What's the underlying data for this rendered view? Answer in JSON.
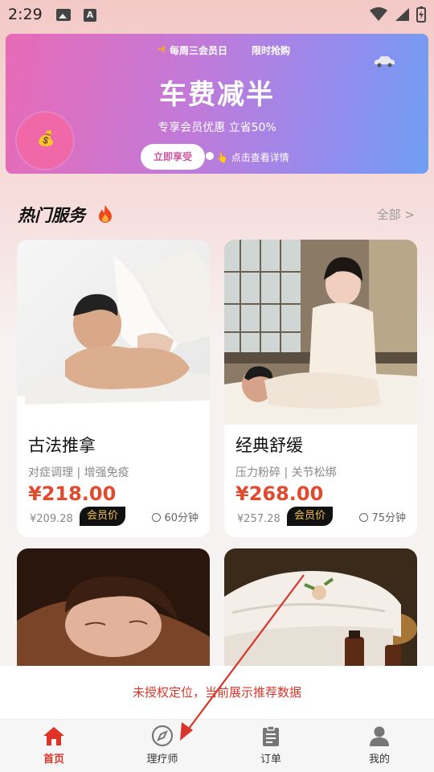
{
  "status_bar": {
    "time": "2:29"
  },
  "banner": {
    "tag_weekly": "每周三会员日",
    "tag_flash": "限时抢购",
    "title": "车费减半",
    "subtitle": "专享会员优惠 立省50%",
    "cta": "立即享受",
    "hint": "👆 点击查看详情",
    "accent": "#d0579f"
  },
  "section": {
    "title": "热门服务",
    "view_all": "全部 >"
  },
  "services": [
    {
      "name": "古法推拿",
      "tags": "对症调理 | 增强免疫",
      "price": "¥218.00",
      "original": "¥209.28",
      "badge": "会员价",
      "duration": "60分钟"
    },
    {
      "name": "经典舒缓",
      "tags": "压力粉碎 | 关节松绑",
      "price": "¥268.00",
      "original": "¥257.28",
      "badge": "会员价",
      "duration": "75分钟"
    }
  ],
  "toast": {
    "message": "未授权定位，当前展示推荐数据"
  },
  "tabbar": {
    "items": [
      {
        "label": "首页",
        "icon": "home-icon",
        "active": true
      },
      {
        "label": "理疗师",
        "icon": "compass-icon",
        "active": false
      },
      {
        "label": "订单",
        "icon": "clipboard-icon",
        "active": false
      },
      {
        "label": "我的",
        "icon": "user-icon",
        "active": false
      }
    ]
  },
  "colors": {
    "price": "#e04b2e",
    "active_tab": "#e03226",
    "toast": "#d9362b"
  }
}
